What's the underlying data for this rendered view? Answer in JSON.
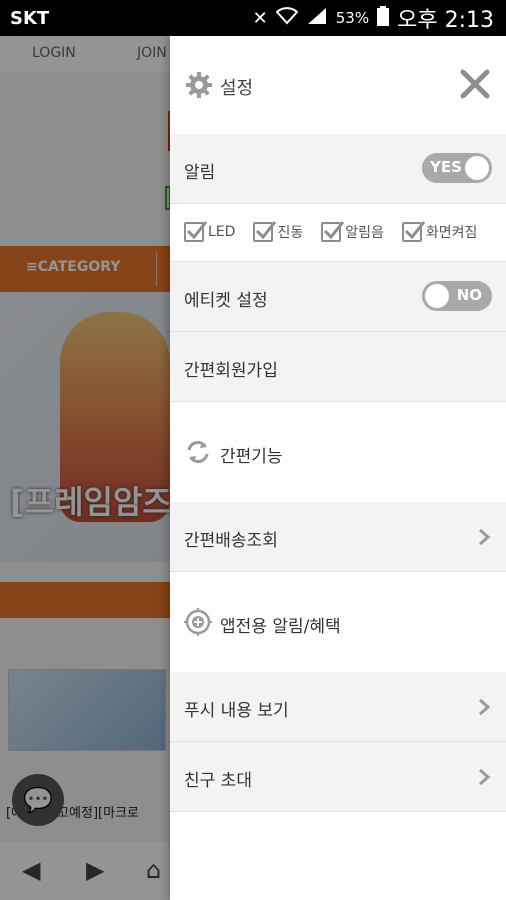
{
  "status_bar": {
    "carrier": "SKT",
    "battery_percent": "53%",
    "time": "오후 2:13"
  },
  "background_page": {
    "nav": [
      "LOGIN",
      "JOIN"
    ],
    "category_label": "≡CATEGORY",
    "hero_text": "[프레임암즈",
    "product_text": "[예약][입고예정][마크로"
  },
  "drawer": {
    "title": "설정",
    "notifications": {
      "label": "알림",
      "toggle": "YES"
    },
    "checkboxes": [
      {
        "label": "LED",
        "checked": true
      },
      {
        "label": "진동",
        "checked": true
      },
      {
        "label": "알림음",
        "checked": true
      },
      {
        "label": "화면켜짐",
        "checked": true
      }
    ],
    "etiquette": {
      "label": "에티켓 설정",
      "toggle": "NO"
    },
    "simple_signup": "간편회원가입",
    "simple_features": "간편기능",
    "shipping_lookup": "간편배송조회",
    "app_alerts": "앱전용 알림/혜택",
    "view_push": "푸시 내용 보기",
    "invite_friends": "친구 초대"
  },
  "colors": {
    "accent_orange": "#e8742a",
    "toggle_gray": "#a9a9a9"
  }
}
